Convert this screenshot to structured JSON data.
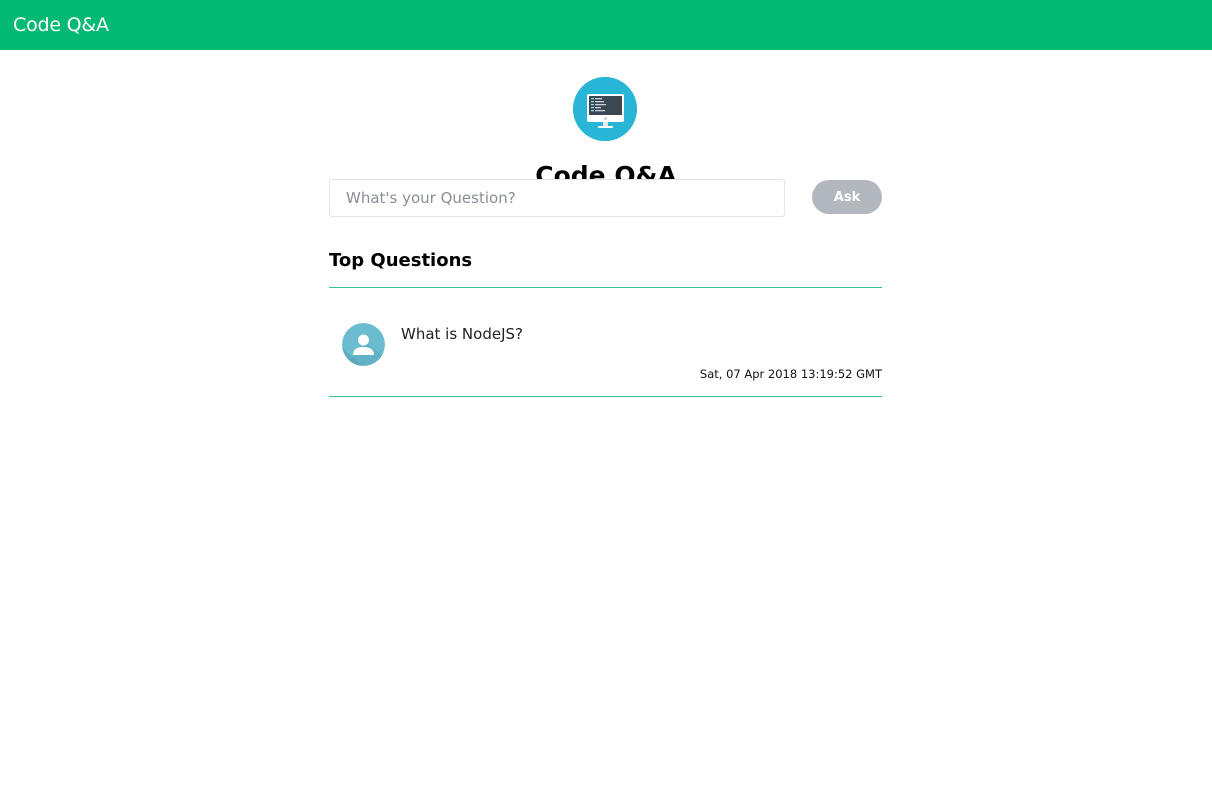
{
  "navbar": {
    "brand": "Code Q&A",
    "background_color": "#04b974"
  },
  "header": {
    "logo_icon": "computer-monitor-icon",
    "title": "Code Q&A"
  },
  "ask_form": {
    "input_value": "",
    "input_placeholder": "What's your Question?",
    "button_label": "Ask",
    "button_color": "#b3b8bf"
  },
  "top_questions": {
    "heading": "Top Questions",
    "divider_color": "#33c194",
    "items": [
      {
        "avatar_icon": "user-avatar-icon",
        "text": "What is NodeJS?",
        "date": "Sat, 07 Apr 2018 13:19:52 GMT"
      }
    ]
  }
}
